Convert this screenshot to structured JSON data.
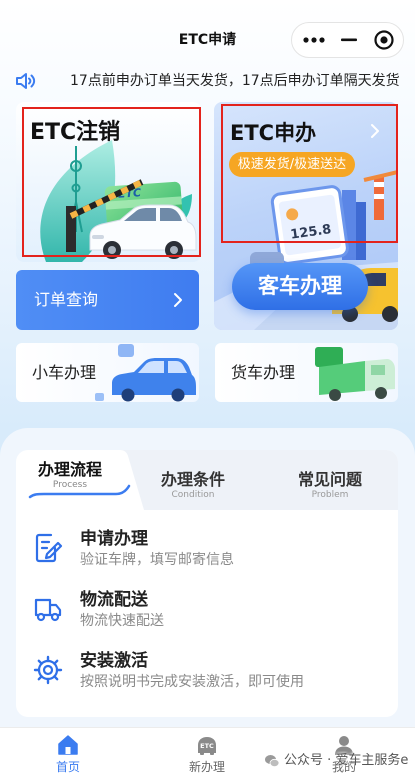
{
  "page": {
    "title": "ETC申请"
  },
  "capsule": {
    "more_icon": "more-dots-icon",
    "minimize_icon": "minimize-icon",
    "close_icon": "target-close-icon"
  },
  "notice": {
    "icon": "speaker-icon",
    "text": "17点前申办订单当天发货，17点后申办订单隔天发货"
  },
  "cards": {
    "cancel": {
      "title": "ETC注销",
      "illustration": "etc-gate-car-illustration",
      "illustration_text": "ETC"
    },
    "apply": {
      "title": "ETC申办",
      "badge": "极速发货/极速送达",
      "arrow_icon": "chevron-right-icon",
      "illustration": "phone-parking-illustration",
      "illustration_text": "125.8"
    },
    "bus": {
      "label": "客车办理"
    },
    "order_query": {
      "label": "订单查询",
      "arrow_icon": "chevron-right-icon"
    },
    "small_car": {
      "label": "小车办理",
      "illustration": "blue-car-illustration"
    },
    "truck": {
      "label": "货车办理",
      "illustration": "green-truck-illustration"
    }
  },
  "process": {
    "tabs": [
      {
        "label": "办理流程",
        "sub": "Process",
        "active": true
      },
      {
        "label": "办理条件",
        "sub": "Condition",
        "active": false
      },
      {
        "label": "常见问题",
        "sub": "Problem",
        "active": false
      }
    ],
    "steps": [
      {
        "icon": "form-edit-icon",
        "title": "申请办理",
        "desc": "验证车牌，填写邮寄信息"
      },
      {
        "icon": "delivery-truck-icon",
        "title": "物流配送",
        "desc": "物流快速配送"
      },
      {
        "icon": "gear-activate-icon",
        "title": "安装激活",
        "desc": "按照说明书完成安装激活，即可使用"
      }
    ]
  },
  "tabbar": [
    {
      "label": "首页",
      "icon": "home-icon",
      "active": true
    },
    {
      "label": "新办理",
      "icon": "etc-car-icon",
      "icon_text": "ETC",
      "active": false
    },
    {
      "label": "我的",
      "icon": "user-icon",
      "active": false
    }
  ],
  "watermark": {
    "icon": "wechat-icon",
    "text": "公众号 · 爱车主服务e"
  },
  "colors": {
    "accent": "#3b7cf0",
    "badge": "#f6a623",
    "highlight_box": "#e3231c",
    "tab_active": "#3b7cf0",
    "tab_inactive": "#666666"
  }
}
